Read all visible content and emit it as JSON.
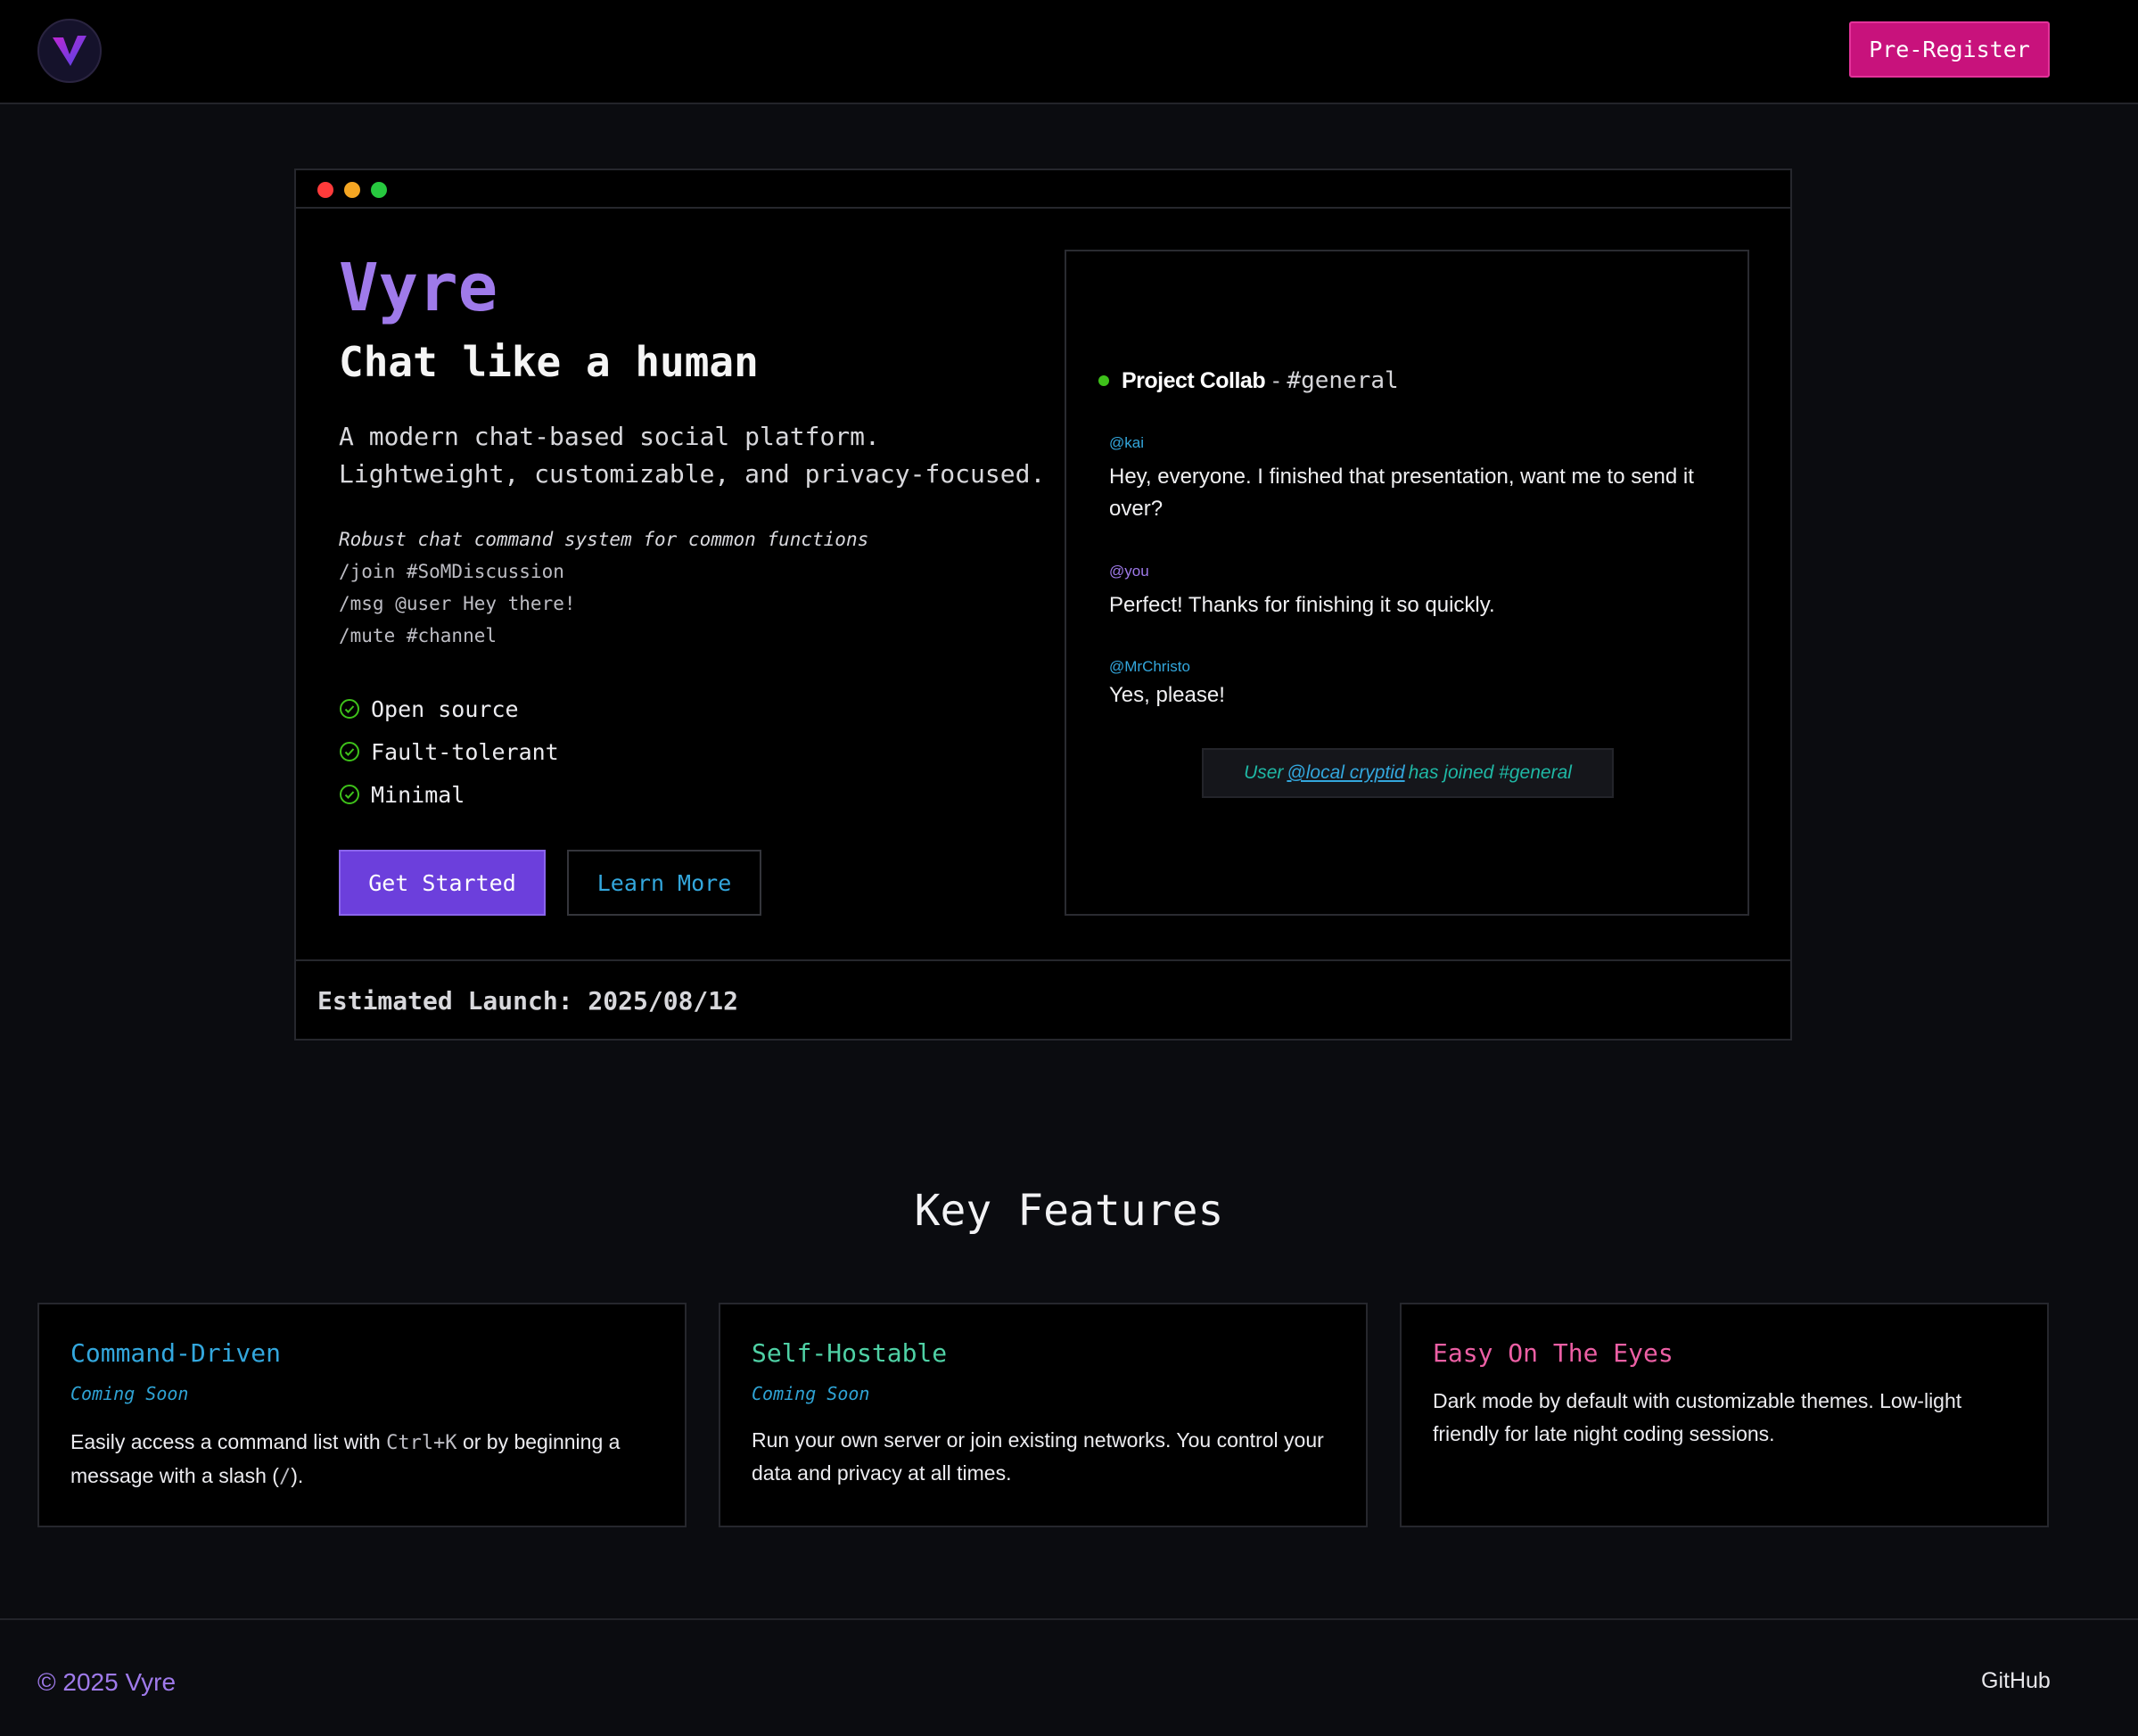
{
  "header": {
    "logo_icon": "vyre-logo-icon",
    "prereg_label": "Pre-Register",
    "accent": "#c8127c"
  },
  "hero": {
    "window_dots": [
      "red",
      "yellow",
      "green"
    ],
    "brand": "Vyre",
    "tagline": "Chat like a human",
    "desc_line1": "A modern chat-based social platform.",
    "desc_line2": "Lightweight, customizable, and privacy-focused.",
    "commands_title": "Robust chat command system for common functions",
    "commands": [
      "/join #SoMDiscussion",
      "/msg @user Hey there!",
      "/mute #channel"
    ],
    "checks": [
      "Open source",
      "Fault-tolerant",
      "Minimal"
    ],
    "get_started": "Get Started",
    "learn_more": "Learn More",
    "launch": "Estimated Launch: 2025/08/12"
  },
  "chat": {
    "channel_name": "Project Collab",
    "separator": "-",
    "channel": "#general",
    "messages": [
      {
        "user": "@kai",
        "text": "Hey, everyone. I finished that presentation, want me to send it over?",
        "color": "#33a7dd"
      },
      {
        "user": "@you",
        "text": "Perfect! Thanks for finishing it so quickly.",
        "color": "#9f7aea"
      },
      {
        "user": "@MrChristo",
        "text": "Yes, please!",
        "color": "#33a7dd"
      }
    ],
    "join_prefix": "User",
    "join_handle": "@local cryptid",
    "join_suffix": "has joined #general"
  },
  "features": {
    "title": "Key Features",
    "cards": [
      {
        "title": "Command-Driven",
        "soon": "Coming Soon",
        "body_pre": "Easily access a command list with",
        "kbd": "Ctrl+K",
        "body_mid": "or by beginning a message with a slash (",
        "slash": "/",
        "body_post": ").",
        "color": "#33a7dd"
      },
      {
        "title": "Self-Hostable",
        "soon": "Coming Soon",
        "body": "Run your own server or join existing networks. You control your data and privacy at all times.",
        "color": "#4fd1a5"
      },
      {
        "title": "Easy On The Eyes",
        "body": "Dark mode by default with customizable themes. Low-light friendly for late night coding sessions.",
        "color": "#ec5fa4"
      }
    ]
  },
  "footer": {
    "copyright": "© 2025 Vyre",
    "github": "GitHub"
  }
}
